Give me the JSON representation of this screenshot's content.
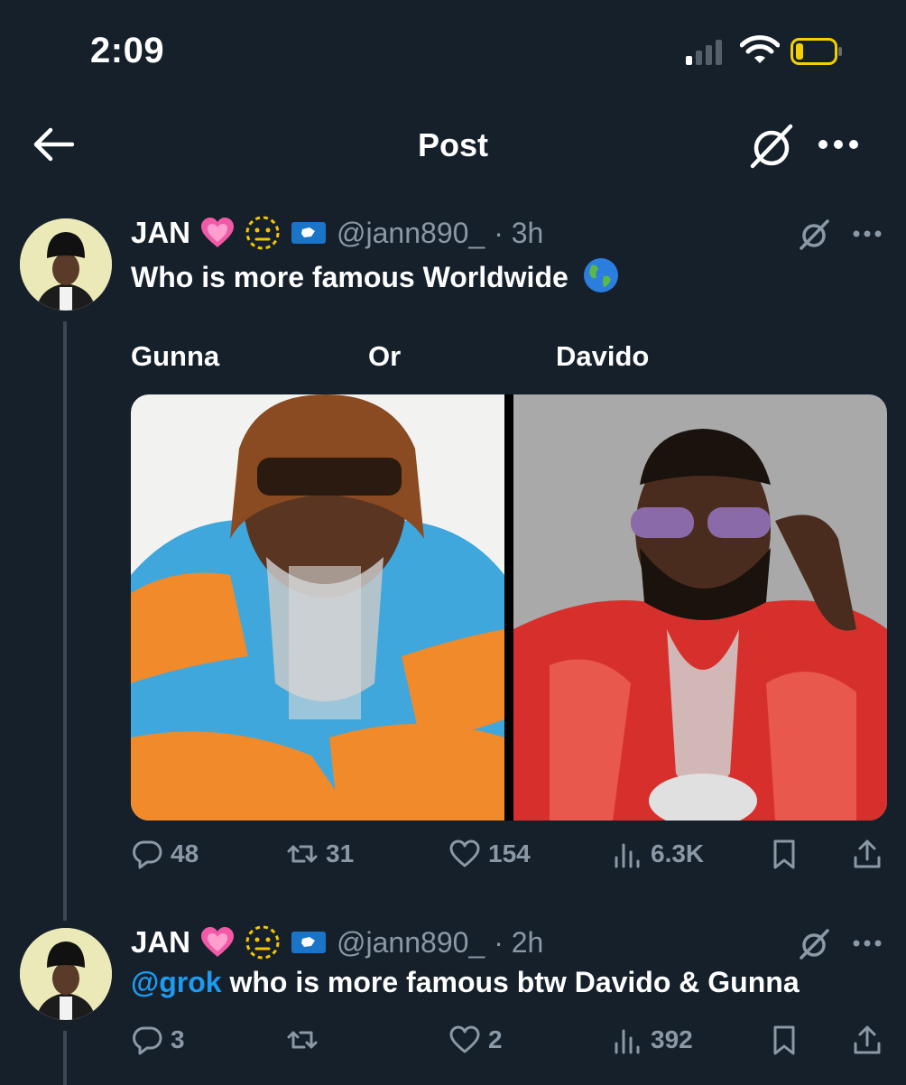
{
  "status_bar": {
    "time": "2:09"
  },
  "header": {
    "title": "Post"
  },
  "post1": {
    "name": "JAN",
    "handle": "@jann890_",
    "time": "· 3h",
    "text": "Who is more famous Worldwide",
    "option_left": "Gunna",
    "option_mid": "Or",
    "option_right": "Davido",
    "replies": "48",
    "reposts": "31",
    "likes": "154",
    "views": "6.3K"
  },
  "post2": {
    "name": "JAN",
    "handle": "@jann890_",
    "time": "· 2h",
    "mention": "@grok",
    "text": " who is more famous btw Davido & Gunna",
    "replies": "3",
    "reposts": "",
    "likes": "2",
    "views": "392"
  },
  "colors": {
    "background": "#15202b",
    "accent": "#1d9bf0",
    "muted": "#8b98a5"
  },
  "icons": [
    "back-arrow-icon",
    "grok-icon",
    "more-icon",
    "heart-emoji",
    "dotted-face-emoji",
    "flag-icon",
    "globe-emoji",
    "reply-icon",
    "repost-icon",
    "like-icon",
    "views-icon",
    "bookmark-icon",
    "share-icon"
  ]
}
